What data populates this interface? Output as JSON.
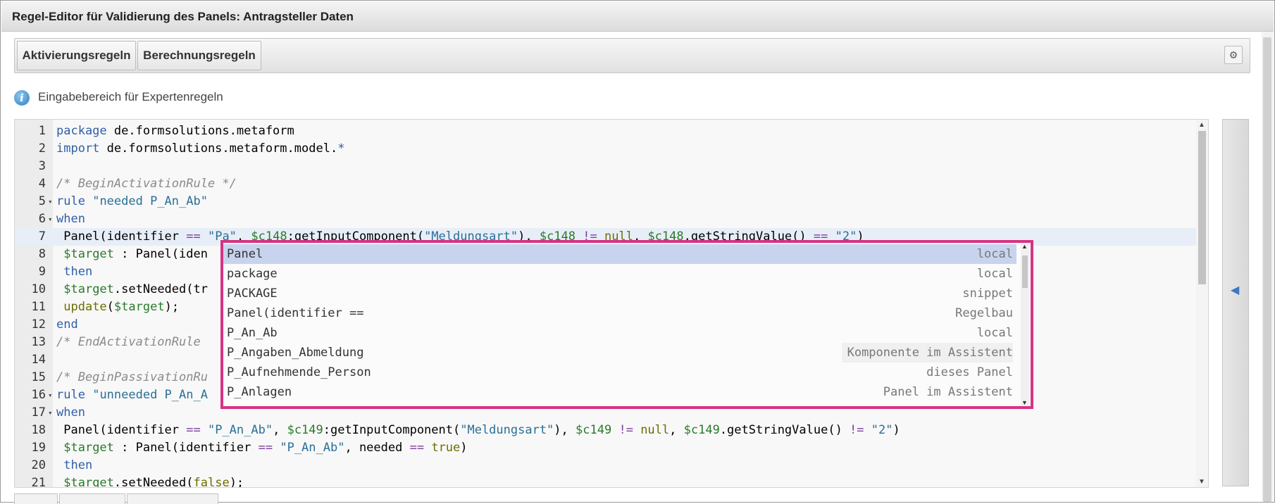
{
  "window": {
    "title": "Regel-Editor für Validierung des Panels: Antragsteller Daten"
  },
  "tabs": [
    {
      "label": "Aktivierungsregeln"
    },
    {
      "label": "Berechnungsregeln"
    }
  ],
  "info": {
    "text": "Eingabebereich für Expertenregeln"
  },
  "editor": {
    "lines": [
      {
        "n": "1",
        "text": "package de.formsolutions.metaform"
      },
      {
        "n": "2",
        "text": "import de.formsolutions.metaform.model.*"
      },
      {
        "n": "3",
        "text": ""
      },
      {
        "n": "4",
        "text": "/* BeginActivationRule */"
      },
      {
        "n": "5",
        "text": "rule \"needed P_An_Ab\""
      },
      {
        "n": "6",
        "text": "when"
      },
      {
        "n": "7",
        "text": " Panel(identifier == \"Pa\", $c148:getInputComponent(\"Meldungsart\"), $c148 != null, $c148.getStringValue() == \"2\")"
      },
      {
        "n": "8",
        "text": " $target : Panel(iden"
      },
      {
        "n": "9",
        "text": " then"
      },
      {
        "n": "10",
        "text": " $target.setNeeded(tr"
      },
      {
        "n": "11",
        "text": " update($target);"
      },
      {
        "n": "12",
        "text": "end"
      },
      {
        "n": "13",
        "text": "/* EndActivationRule"
      },
      {
        "n": "14",
        "text": ""
      },
      {
        "n": "15",
        "text": "/* BeginPassivationRu"
      },
      {
        "n": "16",
        "text": "rule \"unneeded P_An_A"
      },
      {
        "n": "17",
        "text": "when"
      },
      {
        "n": "18",
        "text": " Panel(identifier == \"P_An_Ab\", $c149:getInputComponent(\"Meldungsart\"), $c149 != null, $c149.getStringValue() != \"2\")"
      },
      {
        "n": "19",
        "text": " $target : Panel(identifier == \"P_An_Ab\", needed == true)"
      },
      {
        "n": "20",
        "text": " then"
      },
      {
        "n": "21",
        "text": " $target.setNeeded(false);"
      }
    ]
  },
  "autocomplete": {
    "items": [
      {
        "label": "Panel",
        "meta": "local"
      },
      {
        "label": "package",
        "meta": "local"
      },
      {
        "label": "PACKAGE",
        "meta": "snippet"
      },
      {
        "label": "Panel(identifier ==",
        "meta": "Regelbau"
      },
      {
        "label": "P_An_Ab",
        "meta": "local"
      },
      {
        "label": "P_Angaben_Abmeldung",
        "meta": "Komponente im Assistent"
      },
      {
        "label": "P_Aufnehmende_Person",
        "meta": "dieses Panel"
      },
      {
        "label": "P_Anlagen",
        "meta": "Panel im Assistent"
      }
    ]
  },
  "colors": {
    "highlight_border": "#d63384",
    "selected_item": "#c8d4ee"
  },
  "icons": {
    "settings": "gear-icon",
    "info": "info-icon",
    "collapse": "triangle-left-icon"
  }
}
